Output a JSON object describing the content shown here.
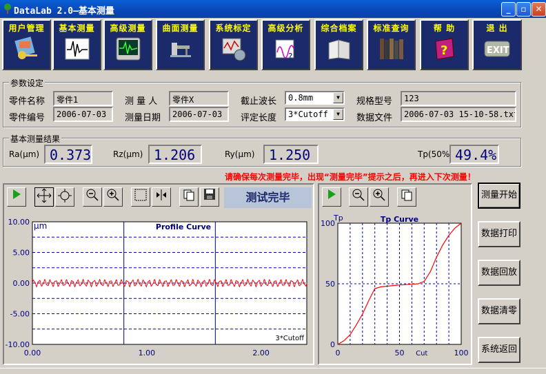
{
  "window": {
    "title": "DataLab 2.0—基本测量",
    "min": "_",
    "max": "▫",
    "close": "✕"
  },
  "toolbar": [
    {
      "label": "用户管理",
      "icon": "user-keys-icon"
    },
    {
      "label": "基本测量",
      "icon": "waveform-monitor-icon"
    },
    {
      "label": "高级测量",
      "icon": "ecg-monitor-icon"
    },
    {
      "label": "曲面测量",
      "icon": "surface-probe-icon"
    },
    {
      "label": "系统标定",
      "icon": "calibration-icon"
    },
    {
      "label": "高级分析",
      "icon": "analysis-chart-icon"
    },
    {
      "label": "综合档案",
      "icon": "archive-book-icon"
    },
    {
      "label": "标准查询",
      "icon": "bookshelf-icon"
    },
    {
      "label": "帮 助",
      "icon": "help-book-icon"
    },
    {
      "label": "退 出",
      "icon": "exit-sign-icon"
    }
  ],
  "params": {
    "title": "参数设定",
    "part_name_label": "零件名称",
    "part_name": "零件1",
    "part_no_label": "零件编号",
    "part_no": "2006-07-03",
    "operator_label": "测 量 人",
    "operator": "零件X",
    "date_label": "测量日期",
    "date": "2006-07-03",
    "cutoff_label": "截止波长",
    "cutoff": "0.8mm",
    "eval_label": "评定长度",
    "eval": "3*Cutoff",
    "spec_label": "规格型号",
    "spec": "123",
    "file_label": "数据文件",
    "file": "2006-07-03 15-10-58.txt"
  },
  "results": {
    "title": "基本测量结果",
    "ra_label": "Ra(μm)",
    "ra": "0.373",
    "rz_label": "Rz(μm)",
    "rz": "1.206",
    "ry_label": "Ry(μm)",
    "ry": "1.250",
    "tp_label": "Tp(50%)",
    "tp": "49.4%"
  },
  "warning": "请确保每次测量完毕，出现“测量完毕”提示之后，再进入下次测量！",
  "status_text": "测试完毕",
  "side_buttons": [
    "测量开始",
    "数据打印",
    "数据回放",
    "数据清零",
    "系统返回"
  ],
  "chart_data": [
    {
      "type": "line",
      "title": "Profile Curve",
      "ylabel": "μm",
      "xlim": [
        0,
        2.4
      ],
      "ylim": [
        -10,
        10
      ],
      "xticks": [
        "0.00",
        "1.00",
        "2.00"
      ],
      "yticks": [
        "10.00",
        "5.00",
        "0.00",
        "-5.00",
        "-10.00"
      ],
      "annotation": "3*Cutoff",
      "series": [
        {
          "color": "#ff0000",
          "amplitude": 0.45,
          "periods": 50,
          "mean": 0
        }
      ]
    },
    {
      "type": "line",
      "title": "Tp Curve",
      "ylabel": "Tp",
      "xlabel": "Cut",
      "xlim": [
        0,
        100
      ],
      "ylim": [
        0,
        100
      ],
      "xticks": [
        "0",
        "50",
        "100"
      ],
      "yticks": [
        "100",
        "50",
        "0"
      ],
      "series": [
        {
          "color": "#ff0000",
          "x": [
            0,
            5,
            10,
            15,
            20,
            25,
            30,
            35,
            40,
            45,
            50,
            55,
            60,
            65,
            70,
            75,
            80,
            85,
            90,
            95,
            100
          ],
          "y": [
            0,
            3,
            8,
            16,
            25,
            36,
            46,
            47.5,
            48,
            48.5,
            49,
            49.3,
            49.6,
            50,
            52,
            60,
            72,
            82,
            90,
            96,
            100
          ]
        }
      ]
    }
  ]
}
